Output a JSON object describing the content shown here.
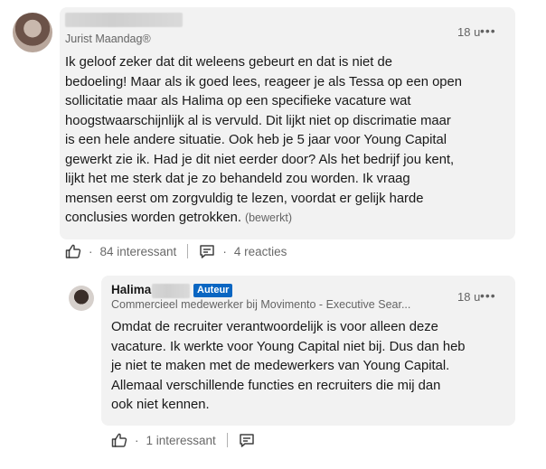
{
  "comment": {
    "author_name_redacted": true,
    "headline": "Jurist Maandag®",
    "time": "18 u",
    "more": "•••",
    "text_lines": [
      "Ik geloof zeker dat dit weleens gebeurt en dat is niet de",
      "bedoeling! Maar als ik goed lees, reageer je als Tessa op een open",
      "sollicitatie maar als Halima op een specifieke vacature wat",
      "hoogstwaarschijnlijk al is vervuld. Dit lijkt niet op discrimatie maar",
      "is een hele andere situatie. Ook heb je 5 jaar voor Young Capital",
      "gewerkt zie ik. Had je dit niet eerder door? Als het bedrijf jou kent,",
      "lijkt het me sterk dat je zo behandeld zou worden. Ik vraag",
      "mensen eerst om zorgvuldig te lezen, voordat er gelijk harde",
      "conclusies worden getrokken."
    ],
    "edited_label": "(bewerkt)",
    "reactions": "84 interessant",
    "replies": "4 reacties",
    "separator": "·"
  },
  "reply": {
    "author_name": "Halima",
    "badge": "Auteur",
    "headline": "Commercieel medewerker bij Movimento - Executive Sear...",
    "time": "18 u",
    "more": "•••",
    "text_lines": [
      "Omdat de recruiter verantwoordelijk is voor alleen deze",
      "vacature. Ik werkte voor Young Capital niet bij. Dus dan heb",
      "je niet te maken met de medewerkers van Young Capital.",
      "Allemaal verschillende functies en recruiters die mij dan",
      "ook niet kennen."
    ],
    "reactions": "1 interessant",
    "separator": "·"
  },
  "icons": {
    "like": "thumbs-up-icon",
    "comment": "comment-icon",
    "more": "more-icon"
  },
  "colors": {
    "bubble": "#f2f2f2",
    "badge": "#0a66c2",
    "text_secondary": "#666666"
  }
}
